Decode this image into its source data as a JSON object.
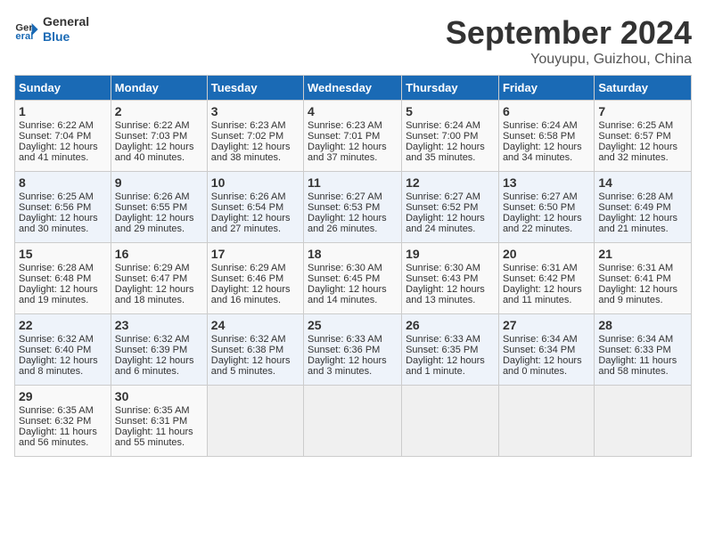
{
  "header": {
    "logo_line1": "General",
    "logo_line2": "Blue",
    "month": "September 2024",
    "location": "Youyupu, Guizhou, China"
  },
  "days_of_week": [
    "Sunday",
    "Monday",
    "Tuesday",
    "Wednesday",
    "Thursday",
    "Friday",
    "Saturday"
  ],
  "weeks": [
    [
      {
        "day": "1",
        "sunrise": "6:22 AM",
        "sunset": "7:04 PM",
        "daylight": "12 hours and 41 minutes."
      },
      {
        "day": "2",
        "sunrise": "6:22 AM",
        "sunset": "7:03 PM",
        "daylight": "12 hours and 40 minutes."
      },
      {
        "day": "3",
        "sunrise": "6:23 AM",
        "sunset": "7:02 PM",
        "daylight": "12 hours and 38 minutes."
      },
      {
        "day": "4",
        "sunrise": "6:23 AM",
        "sunset": "7:01 PM",
        "daylight": "12 hours and 37 minutes."
      },
      {
        "day": "5",
        "sunrise": "6:24 AM",
        "sunset": "7:00 PM",
        "daylight": "12 hours and 35 minutes."
      },
      {
        "day": "6",
        "sunrise": "6:24 AM",
        "sunset": "6:58 PM",
        "daylight": "12 hours and 34 minutes."
      },
      {
        "day": "7",
        "sunrise": "6:25 AM",
        "sunset": "6:57 PM",
        "daylight": "12 hours and 32 minutes."
      }
    ],
    [
      {
        "day": "8",
        "sunrise": "6:25 AM",
        "sunset": "6:56 PM",
        "daylight": "12 hours and 30 minutes."
      },
      {
        "day": "9",
        "sunrise": "6:26 AM",
        "sunset": "6:55 PM",
        "daylight": "12 hours and 29 minutes."
      },
      {
        "day": "10",
        "sunrise": "6:26 AM",
        "sunset": "6:54 PM",
        "daylight": "12 hours and 27 minutes."
      },
      {
        "day": "11",
        "sunrise": "6:27 AM",
        "sunset": "6:53 PM",
        "daylight": "12 hours and 26 minutes."
      },
      {
        "day": "12",
        "sunrise": "6:27 AM",
        "sunset": "6:52 PM",
        "daylight": "12 hours and 24 minutes."
      },
      {
        "day": "13",
        "sunrise": "6:27 AM",
        "sunset": "6:50 PM",
        "daylight": "12 hours and 22 minutes."
      },
      {
        "day": "14",
        "sunrise": "6:28 AM",
        "sunset": "6:49 PM",
        "daylight": "12 hours and 21 minutes."
      }
    ],
    [
      {
        "day": "15",
        "sunrise": "6:28 AM",
        "sunset": "6:48 PM",
        "daylight": "12 hours and 19 minutes."
      },
      {
        "day": "16",
        "sunrise": "6:29 AM",
        "sunset": "6:47 PM",
        "daylight": "12 hours and 18 minutes."
      },
      {
        "day": "17",
        "sunrise": "6:29 AM",
        "sunset": "6:46 PM",
        "daylight": "12 hours and 16 minutes."
      },
      {
        "day": "18",
        "sunrise": "6:30 AM",
        "sunset": "6:45 PM",
        "daylight": "12 hours and 14 minutes."
      },
      {
        "day": "19",
        "sunrise": "6:30 AM",
        "sunset": "6:43 PM",
        "daylight": "12 hours and 13 minutes."
      },
      {
        "day": "20",
        "sunrise": "6:31 AM",
        "sunset": "6:42 PM",
        "daylight": "12 hours and 11 minutes."
      },
      {
        "day": "21",
        "sunrise": "6:31 AM",
        "sunset": "6:41 PM",
        "daylight": "12 hours and 9 minutes."
      }
    ],
    [
      {
        "day": "22",
        "sunrise": "6:32 AM",
        "sunset": "6:40 PM",
        "daylight": "12 hours and 8 minutes."
      },
      {
        "day": "23",
        "sunrise": "6:32 AM",
        "sunset": "6:39 PM",
        "daylight": "12 hours and 6 minutes."
      },
      {
        "day": "24",
        "sunrise": "6:32 AM",
        "sunset": "6:38 PM",
        "daylight": "12 hours and 5 minutes."
      },
      {
        "day": "25",
        "sunrise": "6:33 AM",
        "sunset": "6:36 PM",
        "daylight": "12 hours and 3 minutes."
      },
      {
        "day": "26",
        "sunrise": "6:33 AM",
        "sunset": "6:35 PM",
        "daylight": "12 hours and 1 minute."
      },
      {
        "day": "27",
        "sunrise": "6:34 AM",
        "sunset": "6:34 PM",
        "daylight": "12 hours and 0 minutes."
      },
      {
        "day": "28",
        "sunrise": "6:34 AM",
        "sunset": "6:33 PM",
        "daylight": "11 hours and 58 minutes."
      }
    ],
    [
      {
        "day": "29",
        "sunrise": "6:35 AM",
        "sunset": "6:32 PM",
        "daylight": "11 hours and 56 minutes."
      },
      {
        "day": "30",
        "sunrise": "6:35 AM",
        "sunset": "6:31 PM",
        "daylight": "11 hours and 55 minutes."
      },
      null,
      null,
      null,
      null,
      null
    ]
  ]
}
